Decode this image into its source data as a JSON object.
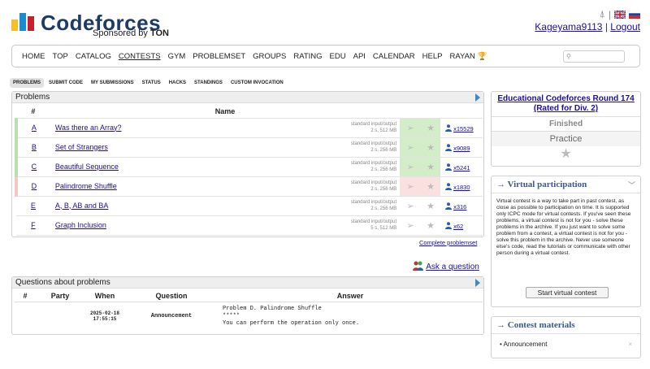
{
  "header": {
    "logo_text": "Codeforces",
    "sponsor_prefix": "Sponsored by",
    "sponsor_name": "TON",
    "username": "Kageyama9113",
    "separator": "|",
    "logout": "Logout"
  },
  "menu": {
    "items": [
      "HOME",
      "TOP",
      "CATALOG",
      "CONTESTS",
      "GYM",
      "PROBLEMSET",
      "GROUPS",
      "RATING",
      "EDU",
      "API",
      "CALENDAR",
      "HELP",
      "RAYAN"
    ],
    "active": "CONTESTS",
    "search_value": ""
  },
  "subtabs": [
    "PROBLEMS",
    "SUBMIT CODE",
    "MY SUBMISSIONS",
    "STATUS",
    "HACKS",
    "STANDINGS",
    "CUSTOM INVOCATION"
  ],
  "problems": {
    "title": "Problems",
    "header": {
      "idx": "#",
      "name": "Name"
    },
    "rows": [
      {
        "idx": "A",
        "name": "Was there an Array?",
        "io": "standard input/output",
        "limits": "2 s, 512 MB",
        "solved": "x15529",
        "status": "accepted"
      },
      {
        "idx": "B",
        "name": "Set of Strangers",
        "io": "standard input/output",
        "limits": "2 s, 256 MB",
        "solved": "x9089",
        "status": "accepted"
      },
      {
        "idx": "C",
        "name": "Beautiful Sequence",
        "io": "standard input/output",
        "limits": "2 s, 256 MB",
        "solved": "x5241",
        "status": "accepted"
      },
      {
        "idx": "D",
        "name": "Palindrome Shuffle",
        "io": "standard input/output",
        "limits": "2 s, 256 MB",
        "solved": "x1830",
        "status": "rejected"
      },
      {
        "idx": "E",
        "name": "A, B, AB and BA",
        "io": "standard input/output",
        "limits": "2 s, 256 MB",
        "solved": "x316",
        "status": "none"
      },
      {
        "idx": "F",
        "name": "Graph Inclusion",
        "io": "standard input/output",
        "limits": "5 s, 512 MB",
        "solved": "x62",
        "status": "none"
      }
    ],
    "complete_link": "Complete problemset"
  },
  "ask_question": "Ask a question",
  "questions": {
    "title": "Questions about problems",
    "header": {
      "num": "#",
      "party": "Party",
      "when": "When",
      "question": "Question",
      "answer": "Answer"
    },
    "row": {
      "num": "",
      "party": "",
      "date": "2025-02-18",
      "time": "17:55:15",
      "question": "Announcement",
      "answer_title": "Problem D. Palindrome Shuffle",
      "answer_stars": "*****",
      "answer_text": "You can perform the operation only once."
    }
  },
  "contest": {
    "title": "Educational Codeforces Round 174 (Rated for Div. 2)",
    "status": "Finished",
    "mode": "Practice"
  },
  "virtual": {
    "heading": "→ Virtual participation",
    "text": "Virtual contest is a way to take part in past contest, as close as possible to participation on time. It is supported only ICPC mode for virtual contests. If you've seen these problems, a virtual contest is not for you - solve these problems in the archive. If you just want to solve some problem from a contest, a virtual contest is not for you - solve this problem in the archive. Never use someone else's code, read the tutorials or communicate with other person during a virtual contest.",
    "button": "Start virtual contest"
  },
  "materials": {
    "heading": "→ Contest materials",
    "item": "Announcement",
    "close": "×"
  },
  "colors": {
    "accepted": "#d4edc9",
    "rejected": "#fbe0e0",
    "link": "#1a0dab",
    "logo_blue": "#1e3a68"
  }
}
